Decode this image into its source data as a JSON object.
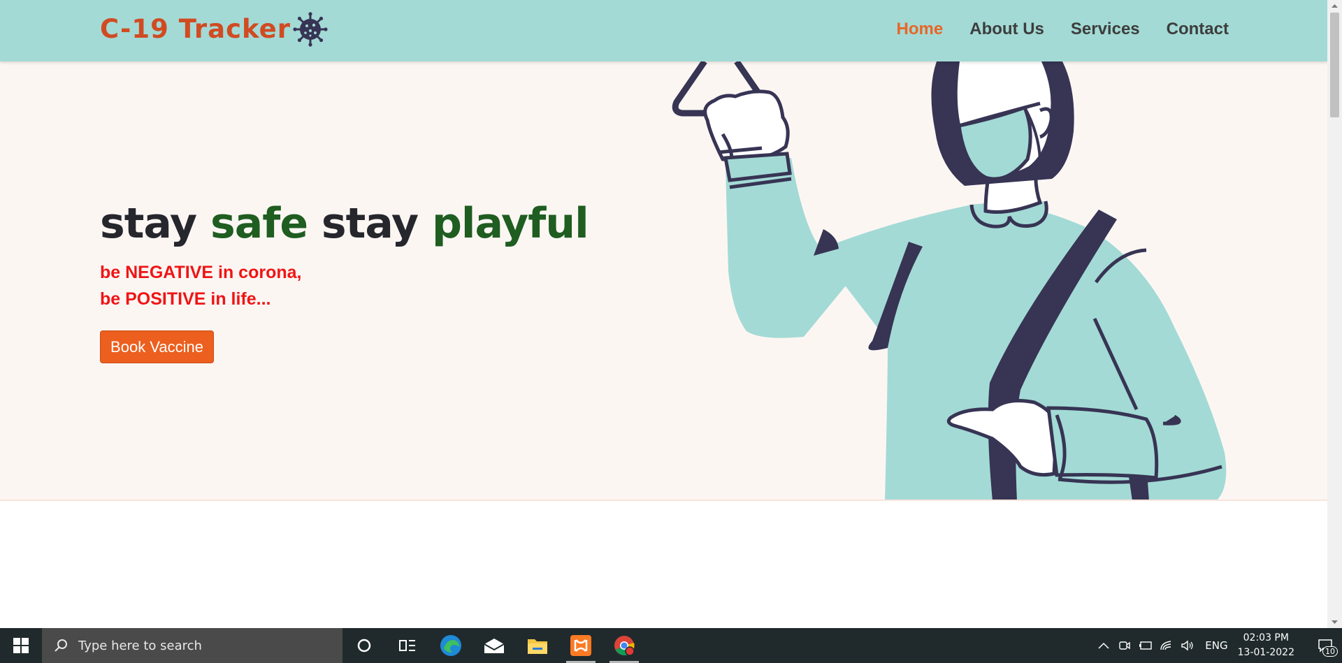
{
  "header": {
    "logo_text": "C-19 Tracker",
    "nav": [
      {
        "label": "Home",
        "active": true
      },
      {
        "label": "About Us",
        "active": false
      },
      {
        "label": "Services",
        "active": false
      },
      {
        "label": "Contact",
        "active": false
      }
    ]
  },
  "hero": {
    "headline": {
      "word1": "stay ",
      "word2": "safe",
      "word3": " stay ",
      "word4": "playful"
    },
    "tagline_line1": "be NEGATIVE in corona,",
    "tagline_line2": "be POSITIVE in life...",
    "button_label": "Book Vaccine"
  },
  "taskbar": {
    "search_placeholder": "Type here to search",
    "apps": [
      "cortana-icon",
      "task-view-icon",
      "edge-icon",
      "mail-icon",
      "file-explorer-icon",
      "xampp-icon",
      "chrome-icon"
    ],
    "language": "ENG",
    "time": "02:03 PM",
    "date": "13-01-2022",
    "notification_count": "10"
  },
  "colors": {
    "header_bg": "#a3dad5",
    "logo": "#d14b22",
    "nav_active": "#e86627",
    "headline_green": "#1f5d21",
    "tagline_red": "#ef1515",
    "button": "#ec5f1e",
    "hero_bg": "#fcf6f3",
    "illustration_mint": "#a3dad5",
    "illustration_navy": "#373454"
  }
}
